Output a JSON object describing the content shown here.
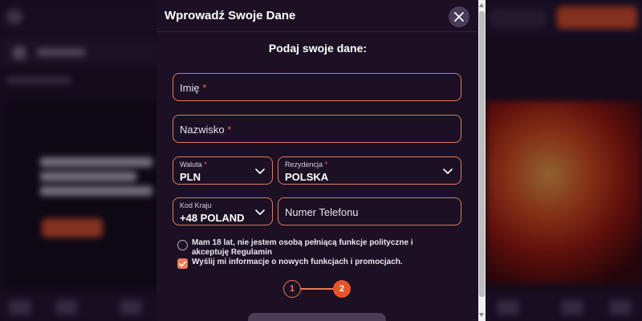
{
  "modal": {
    "title": "Wprowadź Swoje Dane",
    "section_title": "Podaj swoje dane:"
  },
  "fields": {
    "first_name": {
      "placeholder": "Imię",
      "required_mark": "*"
    },
    "last_name": {
      "placeholder": "Nazwisko",
      "required_mark": "*"
    },
    "currency": {
      "label": "Waluta",
      "required_mark": "*",
      "value": "PLN"
    },
    "residence": {
      "label": "Rezydencja",
      "required_mark": "*",
      "value": "POLSKA"
    },
    "country_code": {
      "label": "Kod Kraju",
      "value": "+48 POLAND"
    },
    "phone": {
      "placeholder": "Numer Telefonu"
    }
  },
  "consents": {
    "age_terms": {
      "text": "Mam 18 lat, nie jestem osobą pełniącą funkcje polityczne i akceptuję Regulamin",
      "checked": false
    },
    "newsletter": {
      "text": "Wyślij mi informacje o nowych funkcjach i promocjach.",
      "checked": true
    }
  },
  "steps": {
    "step1": "1",
    "step2": "2",
    "current": 2
  },
  "colors": {
    "accent": "#f07a52",
    "field_border": "#e07a5f",
    "required": "#ff5b4a",
    "modal_bg": "#1b1024"
  },
  "icons": [
    "close-icon",
    "chevron-down-icon",
    "check-icon"
  ]
}
